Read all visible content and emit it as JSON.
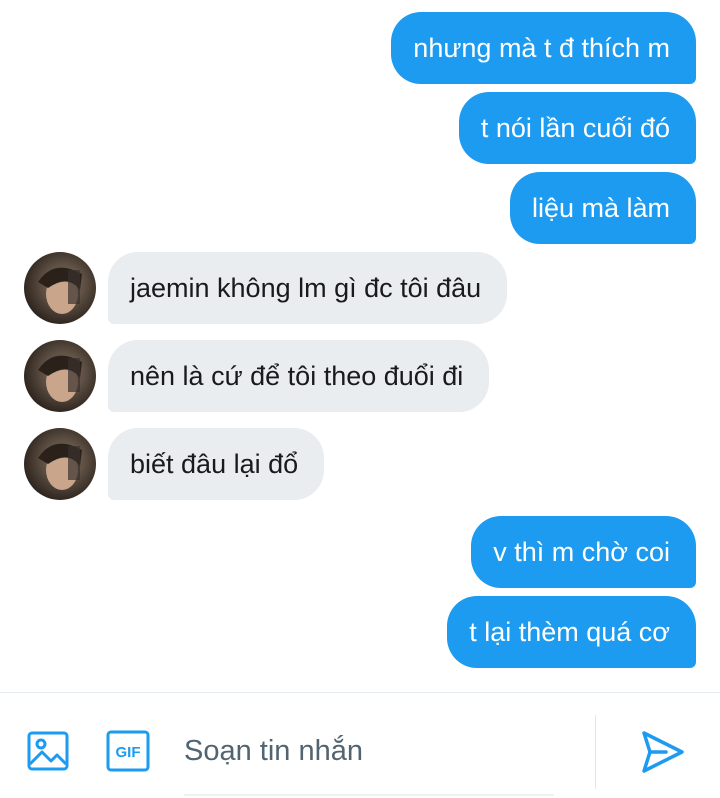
{
  "messages": [
    {
      "dir": "out",
      "text": "nhưng mà t đ thích m"
    },
    {
      "dir": "out",
      "text": "t nói lần cuối đó"
    },
    {
      "dir": "out",
      "text": "liệu mà làm"
    },
    {
      "dir": "in",
      "text": "jaemin không lm gì đc tôi đâu"
    },
    {
      "dir": "in",
      "text": "nên là cứ để tôi theo đuổi đi"
    },
    {
      "dir": "in",
      "text": "biết đâu lại đổ"
    },
    {
      "dir": "out",
      "text": "v thì m chờ coi"
    },
    {
      "dir": "out",
      "text": "t lại thèm quá cơ"
    }
  ],
  "composer": {
    "placeholder": "Soạn tin nhắn",
    "gif_label": "GIF",
    "image_icon": "image-icon",
    "gif_icon": "gif-icon",
    "send_icon": "send-icon"
  },
  "colors": {
    "accent": "#1d9bf0",
    "incoming_bubble": "#e9edf0"
  }
}
